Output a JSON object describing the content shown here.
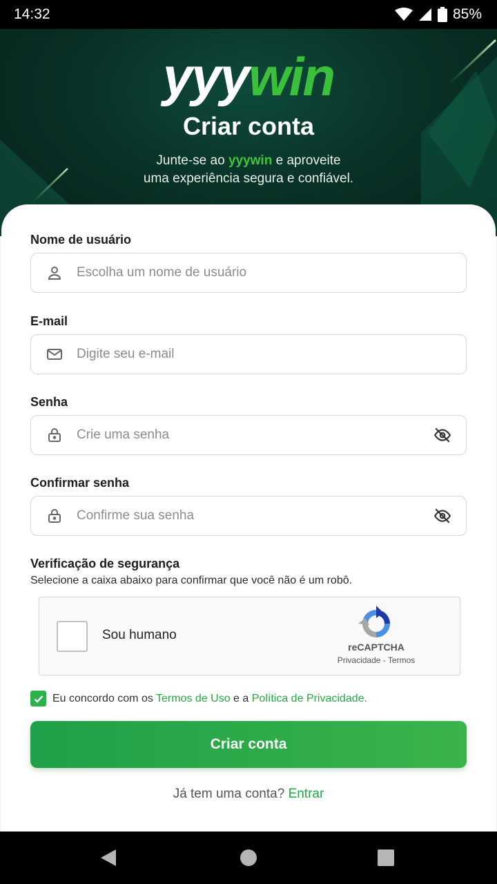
{
  "status_bar": {
    "time": "14:32",
    "battery": "85%",
    "icons": [
      "wifi-icon",
      "signal-icon",
      "battery-icon"
    ]
  },
  "brand": {
    "logo_white": "yyy",
    "logo_green": "win",
    "green_color": "#3cc03c"
  },
  "hero": {
    "title": "Criar conta",
    "subtitle_pre": "Junte-se ao ",
    "subtitle_brand": "yyywin",
    "subtitle_post": " e aproveite",
    "subtitle_line2": "uma experiência segura e confiável."
  },
  "form": {
    "username": {
      "label": "Nome de usuário",
      "placeholder": "Escolha um nome de usuário",
      "value": "",
      "icon": "user-icon"
    },
    "email": {
      "label": "E-mail",
      "placeholder": "Digite seu e-mail",
      "value": "",
      "icon": "mail-icon"
    },
    "password": {
      "label": "Senha",
      "placeholder": "Crie uma senha",
      "value": "",
      "icon": "lock-icon",
      "toggle_icon": "eye-off-icon"
    },
    "confirm": {
      "label": "Confirmar senha",
      "placeholder": "Confirme sua senha",
      "value": "",
      "icon": "lock-icon",
      "toggle_icon": "eye-off-icon"
    }
  },
  "verification": {
    "title": "Verificação de segurança",
    "description": "Selecione a caixa abaixo para confirmar que você não é um robô.",
    "captcha_label": "Sou humano",
    "captcha_brand": "reCAPTCHA",
    "captcha_links": "Privacidade - Termos",
    "checked": false
  },
  "agreement": {
    "checked": true,
    "text_pre": "Eu concordo com os ",
    "terms_link": "Termos de Uso",
    "text_mid": " e a ",
    "privacy_link": "Política de Privacidade."
  },
  "submit_label": "Criar conta",
  "login": {
    "prompt": "Já tem uma conta? ",
    "link": "Entrar"
  },
  "colors": {
    "accent": "#2db24b",
    "hero_dark": "#062019"
  }
}
